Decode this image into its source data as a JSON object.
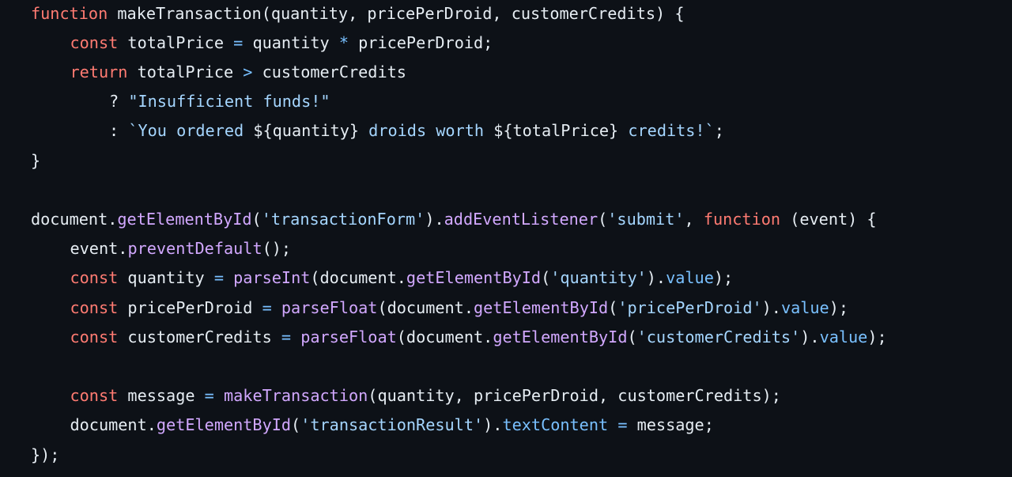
{
  "colors": {
    "background": "#0d1117",
    "default": "#e6edf3",
    "keyword": "#ff7b72",
    "function": "#d2a8ff",
    "string": "#a5d6ff",
    "property": "#79c0ff",
    "operator": "#79c0ff"
  },
  "code": {
    "lines": [
      {
        "indent": 0,
        "tokens": [
          {
            "t": "function",
            "c": "keyword"
          },
          {
            "t": " makeTransaction(quantity, pricePerDroid, customerCredits) {",
            "c": "default"
          }
        ]
      },
      {
        "indent": 1,
        "tokens": [
          {
            "t": "const",
            "c": "keyword"
          },
          {
            "t": " totalPrice ",
            "c": "default"
          },
          {
            "t": "=",
            "c": "operator"
          },
          {
            "t": " quantity ",
            "c": "default"
          },
          {
            "t": "*",
            "c": "operator"
          },
          {
            "t": " pricePerDroid;",
            "c": "default"
          }
        ]
      },
      {
        "indent": 1,
        "tokens": [
          {
            "t": "return",
            "c": "keyword"
          },
          {
            "t": " totalPrice ",
            "c": "default"
          },
          {
            "t": ">",
            "c": "operator"
          },
          {
            "t": " customerCredits",
            "c": "default"
          }
        ]
      },
      {
        "indent": 2,
        "tokens": [
          {
            "t": "? ",
            "c": "default"
          },
          {
            "t": "\"Insufficient funds!\"",
            "c": "string"
          }
        ]
      },
      {
        "indent": 2,
        "tokens": [
          {
            "t": ": ",
            "c": "default"
          },
          {
            "t": "`You ordered ",
            "c": "string"
          },
          {
            "t": "${quantity}",
            "c": "default"
          },
          {
            "t": " droids worth ",
            "c": "string"
          },
          {
            "t": "${totalPrice}",
            "c": "default"
          },
          {
            "t": " credits!`",
            "c": "string"
          },
          {
            "t": ";",
            "c": "default"
          }
        ]
      },
      {
        "indent": 0,
        "tokens": [
          {
            "t": "}",
            "c": "default"
          }
        ]
      },
      {
        "indent": 0,
        "tokens": []
      },
      {
        "indent": 0,
        "tokens": [
          {
            "t": "document.",
            "c": "default"
          },
          {
            "t": "getElementById",
            "c": "function"
          },
          {
            "t": "(",
            "c": "default"
          },
          {
            "t": "'transactionForm'",
            "c": "string"
          },
          {
            "t": ").",
            "c": "default"
          },
          {
            "t": "addEventListener",
            "c": "function"
          },
          {
            "t": "(",
            "c": "default"
          },
          {
            "t": "'submit'",
            "c": "string"
          },
          {
            "t": ", ",
            "c": "default"
          },
          {
            "t": "function",
            "c": "keyword"
          },
          {
            "t": " (event) {",
            "c": "default"
          }
        ]
      },
      {
        "indent": 1,
        "tokens": [
          {
            "t": "event.",
            "c": "default"
          },
          {
            "t": "preventDefault",
            "c": "function"
          },
          {
            "t": "();",
            "c": "default"
          }
        ]
      },
      {
        "indent": 1,
        "tokens": [
          {
            "t": "const",
            "c": "keyword"
          },
          {
            "t": " quantity ",
            "c": "default"
          },
          {
            "t": "=",
            "c": "operator"
          },
          {
            "t": " ",
            "c": "default"
          },
          {
            "t": "parseInt",
            "c": "function"
          },
          {
            "t": "(document.",
            "c": "default"
          },
          {
            "t": "getElementById",
            "c": "function"
          },
          {
            "t": "(",
            "c": "default"
          },
          {
            "t": "'quantity'",
            "c": "string"
          },
          {
            "t": ").",
            "c": "default"
          },
          {
            "t": "value",
            "c": "property"
          },
          {
            "t": ");",
            "c": "default"
          }
        ]
      },
      {
        "indent": 1,
        "tokens": [
          {
            "t": "const",
            "c": "keyword"
          },
          {
            "t": " pricePerDroid ",
            "c": "default"
          },
          {
            "t": "=",
            "c": "operator"
          },
          {
            "t": " ",
            "c": "default"
          },
          {
            "t": "parseFloat",
            "c": "function"
          },
          {
            "t": "(document.",
            "c": "default"
          },
          {
            "t": "getElementById",
            "c": "function"
          },
          {
            "t": "(",
            "c": "default"
          },
          {
            "t": "'pricePerDroid'",
            "c": "string"
          },
          {
            "t": ").",
            "c": "default"
          },
          {
            "t": "value",
            "c": "property"
          },
          {
            "t": ");",
            "c": "default"
          }
        ]
      },
      {
        "indent": 1,
        "tokens": [
          {
            "t": "const",
            "c": "keyword"
          },
          {
            "t": " customerCredits ",
            "c": "default"
          },
          {
            "t": "=",
            "c": "operator"
          },
          {
            "t": " ",
            "c": "default"
          },
          {
            "t": "parseFloat",
            "c": "function"
          },
          {
            "t": "(document.",
            "c": "default"
          },
          {
            "t": "getElementById",
            "c": "function"
          },
          {
            "t": "(",
            "c": "default"
          },
          {
            "t": "'customerCredits'",
            "c": "string"
          },
          {
            "t": ").",
            "c": "default"
          },
          {
            "t": "value",
            "c": "property"
          },
          {
            "t": ");",
            "c": "default"
          }
        ]
      },
      {
        "indent": 0,
        "tokens": []
      },
      {
        "indent": 1,
        "tokens": [
          {
            "t": "const",
            "c": "keyword"
          },
          {
            "t": " message ",
            "c": "default"
          },
          {
            "t": "=",
            "c": "operator"
          },
          {
            "t": " ",
            "c": "default"
          },
          {
            "t": "makeTransaction",
            "c": "function"
          },
          {
            "t": "(quantity, pricePerDroid, customerCredits);",
            "c": "default"
          }
        ]
      },
      {
        "indent": 1,
        "tokens": [
          {
            "t": "document.",
            "c": "default"
          },
          {
            "t": "getElementById",
            "c": "function"
          },
          {
            "t": "(",
            "c": "default"
          },
          {
            "t": "'transactionResult'",
            "c": "string"
          },
          {
            "t": ").",
            "c": "default"
          },
          {
            "t": "textContent",
            "c": "property"
          },
          {
            "t": " ",
            "c": "default"
          },
          {
            "t": "=",
            "c": "operator"
          },
          {
            "t": " message;",
            "c": "default"
          }
        ]
      },
      {
        "indent": 0,
        "tokens": [
          {
            "t": "});",
            "c": "default"
          }
        ]
      }
    ]
  }
}
